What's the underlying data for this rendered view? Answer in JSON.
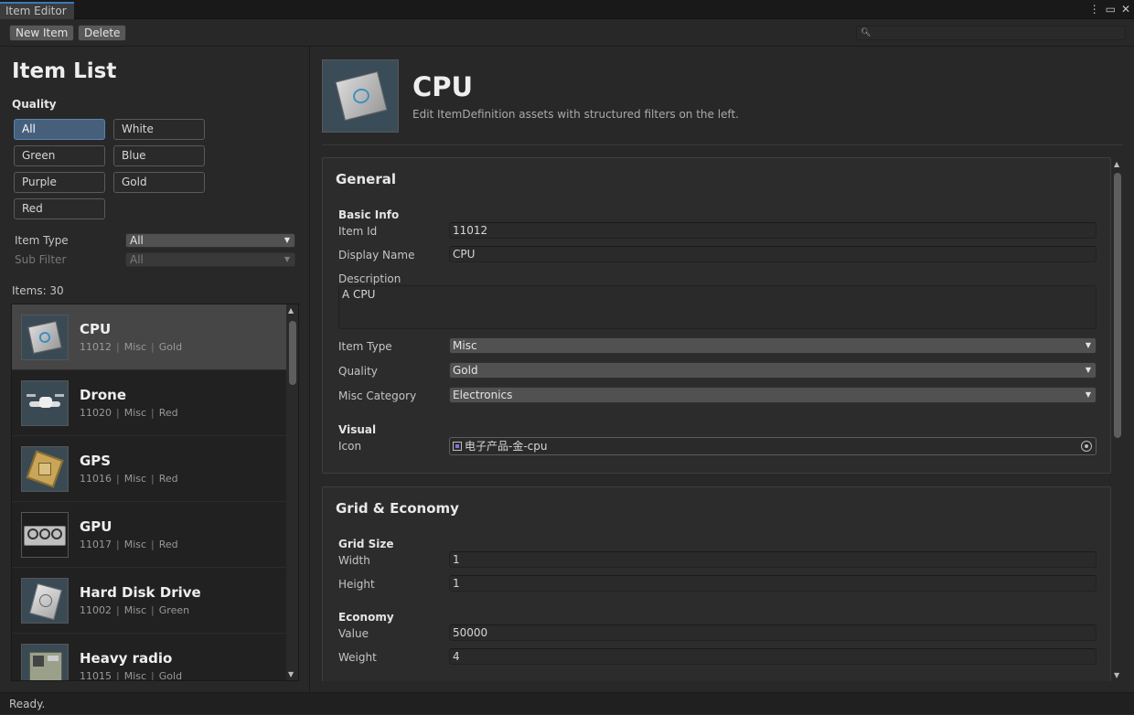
{
  "window": {
    "tab_title": "Item Editor",
    "controls": [
      "⋮",
      "▭",
      "✕"
    ]
  },
  "toolbar": {
    "new_item_label": "New Item",
    "delete_label": "Delete",
    "search_value": ""
  },
  "left": {
    "title": "Item List",
    "quality_label": "Quality",
    "quality_options": [
      "All",
      "White",
      "Green",
      "Blue",
      "Purple",
      "Gold",
      "Red"
    ],
    "quality_selected": "All",
    "item_type_label": "Item Type",
    "item_type_value": "All",
    "sub_filter_label": "Sub Filter",
    "sub_filter_value": "All",
    "count_text": "Items: 30",
    "items": [
      {
        "name": "CPU",
        "id": "11012",
        "type": "Misc",
        "quality": "Gold",
        "icon": "cpu-chip-icon"
      },
      {
        "name": "Drone",
        "id": "11020",
        "type": "Misc",
        "quality": "Red",
        "icon": "drone-icon"
      },
      {
        "name": "GPS",
        "id": "11016",
        "type": "Misc",
        "quality": "Red",
        "icon": "gps-module-icon"
      },
      {
        "name": "GPU",
        "id": "11017",
        "type": "Misc",
        "quality": "Red",
        "icon": "gpu-card-icon"
      },
      {
        "name": "Hard Disk Drive",
        "id": "11002",
        "type": "Misc",
        "quality": "Green",
        "icon": "hard-disk-icon"
      },
      {
        "name": "Heavy radio",
        "id": "11015",
        "type": "Misc",
        "quality": "Gold",
        "icon": "radio-icon"
      }
    ]
  },
  "detail": {
    "title": "CPU",
    "subtitle": "Edit ItemDefinition assets with structured filters on the left.",
    "general": {
      "header": "General",
      "basic_info": "Basic Info",
      "item_id_label": "Item Id",
      "item_id": "11012",
      "display_name_label": "Display Name",
      "display_name": "CPU",
      "description_label": "Description",
      "description": "A CPU",
      "item_type_label": "Item Type",
      "item_type": "Misc",
      "quality_label": "Quality",
      "quality": "Gold",
      "misc_category_label": "Misc Category",
      "misc_category": "Electronics",
      "visual": "Visual",
      "icon_label": "Icon",
      "icon_value": "电子产品-金-cpu"
    },
    "grid_economy": {
      "header": "Grid & Economy",
      "grid_size": "Grid Size",
      "width_label": "Width",
      "width": "1",
      "height_label": "Height",
      "height": "1",
      "economy": "Economy",
      "value_label": "Value",
      "value": "50000",
      "weight_label": "Weight",
      "weight": "4"
    }
  },
  "status": "Ready."
}
